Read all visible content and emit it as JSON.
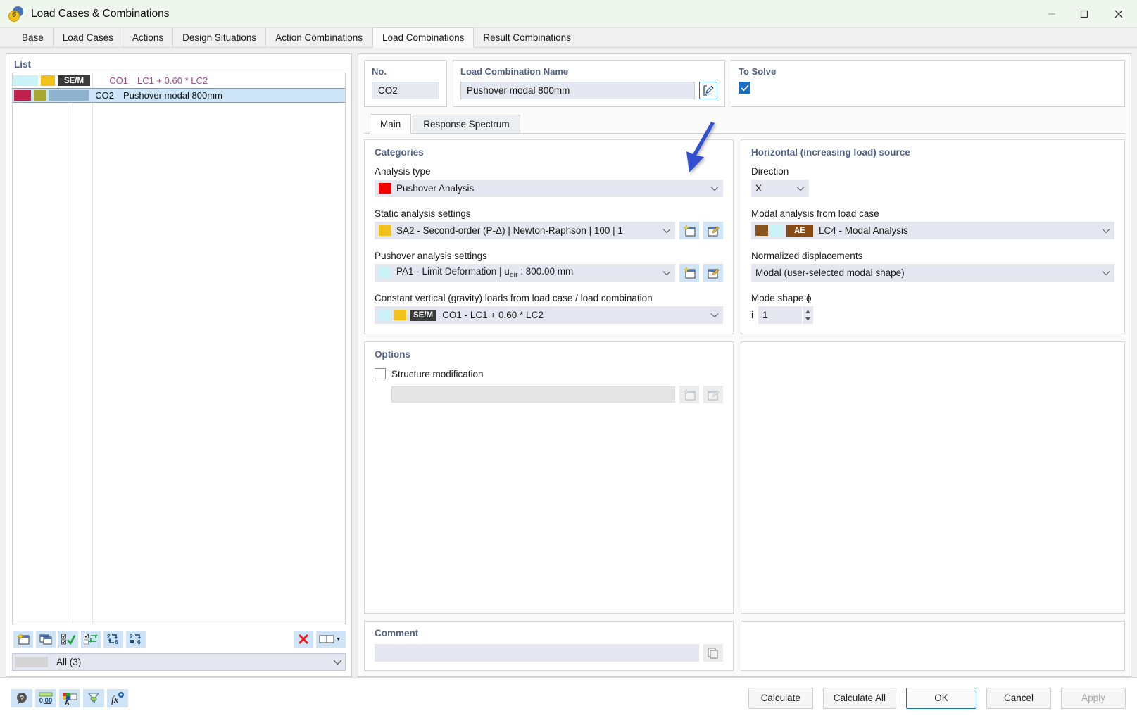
{
  "window": {
    "title": "Load Cases & Combinations",
    "app_icon": "rfem6-logo-icon",
    "minimize": "minimize-icon",
    "maximize": "maximize-icon",
    "close": "close-icon"
  },
  "tabs": [
    {
      "label": "Base",
      "active": false
    },
    {
      "label": "Load Cases",
      "active": false
    },
    {
      "label": "Actions",
      "active": false
    },
    {
      "label": "Design Situations",
      "active": false
    },
    {
      "label": "Action Combinations",
      "active": false
    },
    {
      "label": "Load Combinations",
      "active": true
    },
    {
      "label": "Result Combinations",
      "active": false
    }
  ],
  "list": {
    "title": "List",
    "rows": [
      {
        "no": "CO1",
        "description": "LC1 + 0.60 * LC2",
        "tag": "SE/M",
        "tag_color": "#3a3a3a",
        "swatch_a": "#c9f3f7",
        "swatch_b": "#f2c11c",
        "selected": false
      },
      {
        "no": "CO2",
        "description": "Pushover modal 800mm",
        "tag": "",
        "tag_color": "#8fb4d0",
        "swatch_a": "#c0204b",
        "swatch_b": "#a8a832",
        "selected": true
      }
    ],
    "toolbar": [
      {
        "name": "new-load-combination-button",
        "icon": "new-window-icon"
      },
      {
        "name": "copy-load-combination-button",
        "icon": "copy-window-icon"
      },
      {
        "name": "select-all-button",
        "icon": "check-all-icon"
      },
      {
        "name": "invert-selection-button",
        "icon": "invert-selection-icon"
      },
      {
        "name": "renumber-button",
        "icon": "renumber-icon"
      },
      {
        "name": "resequence-button",
        "icon": "resequence-icon"
      },
      {
        "name": "delete-button",
        "icon": "red-x-icon"
      },
      {
        "name": "view-mode-button",
        "icon": "two-pane-icon"
      }
    ],
    "filter": {
      "label": "All",
      "count": "(3)",
      "display": "All (3)",
      "chevron": "chevron-down-icon"
    }
  },
  "header": {
    "no": {
      "label": "No.",
      "value": "CO2"
    },
    "name": {
      "label": "Load Combination Name",
      "value": "Pushover modal 800mm",
      "edit_icon": "pencil-edit-icon"
    },
    "to_solve": {
      "label": "To Solve",
      "checked": true
    }
  },
  "inner_tabs": [
    {
      "label": "Main",
      "active": true
    },
    {
      "label": "Response Spectrum",
      "active": false
    }
  ],
  "categories": {
    "title": "Categories",
    "analysis_type": {
      "label": "Analysis type",
      "value": "Pushover Analysis",
      "swatch": "#f50000",
      "chevron": "chevron-down-icon"
    },
    "static_analysis": {
      "label": "Static analysis settings",
      "value": "SA2 - Second-order (P-Δ) | Newton-Raphson | 100 | 1",
      "swatch": "#f2c11c",
      "chevron": "chevron-down-icon",
      "new_icon": "new-item-icon",
      "edit_icon": "edit-item-icon"
    },
    "pushover_analysis": {
      "label": "Pushover analysis settings",
      "value_prefix": "PA1 - Limit Deformation | u",
      "value_sub": "dir",
      "value_suffix": " : 800.00 mm",
      "value": "PA1 - Limit Deformation | udir : 800.00 mm",
      "swatch": "#c9f3f7",
      "chevron": "chevron-down-icon",
      "new_icon": "new-item-icon",
      "edit_icon": "edit-item-icon"
    },
    "constant_vertical": {
      "label": "Constant vertical (gravity) loads from load case / load combination",
      "value": "CO1 - LC1 + 0.60 * LC2",
      "swatch_a": "#c9f3f7",
      "swatch_b": "#f2c11c",
      "tag": "SE/M",
      "tag_color": "#3a3a3a",
      "chevron": "chevron-down-icon"
    }
  },
  "horizontal": {
    "title": "Horizontal (increasing load) source",
    "direction": {
      "label": "Direction",
      "value": "X",
      "chevron": "chevron-down-icon"
    },
    "modal_load_case": {
      "label": "Modal analysis from load case",
      "value": "LC4 - Modal Analysis",
      "swatch_a": "#8a5620",
      "swatch_b": "#c9f3f7",
      "tag": "AE",
      "tag_color": "#8a4a14",
      "chevron": "chevron-down-icon"
    },
    "normalized_displacements": {
      "label": "Normalized displacements",
      "value": "Modal (user-selected modal shape)",
      "chevron": "chevron-down-icon"
    },
    "mode_shape": {
      "label": "Mode shape ϕ",
      "index_label": "i",
      "value": "1",
      "spinner": "spinner-up-down-icon"
    }
  },
  "options": {
    "title": "Options",
    "structure_modification": {
      "label": "Structure modification",
      "checked": false,
      "value": ""
    },
    "new_icon": "new-item-icon",
    "edit_icon": "edit-item-icon"
  },
  "comment": {
    "title": "Comment",
    "value": "",
    "chevron": "chevron-down-icon",
    "copy_icon": "clipboard-icon"
  },
  "footer": {
    "icons": [
      {
        "name": "help-button",
        "icon": "question-bubble-icon"
      },
      {
        "name": "units-button",
        "icon": "decimal-places-icon"
      },
      {
        "name": "display-properties-button",
        "icon": "color-text-icon"
      },
      {
        "name": "filter-button",
        "icon": "funnel-icon"
      },
      {
        "name": "formula-button",
        "icon": "fx-icon"
      }
    ],
    "buttons": [
      {
        "label": "Calculate",
        "style": "normal"
      },
      {
        "label": "Calculate All",
        "style": "normal"
      },
      {
        "label": "OK",
        "style": "primary"
      },
      {
        "label": "Cancel",
        "style": "normal"
      },
      {
        "label": "Apply",
        "style": "disabled"
      }
    ]
  },
  "annotation": {
    "arrow": "blue-arrow-pointing-down-left",
    "color": "#3250d0"
  }
}
